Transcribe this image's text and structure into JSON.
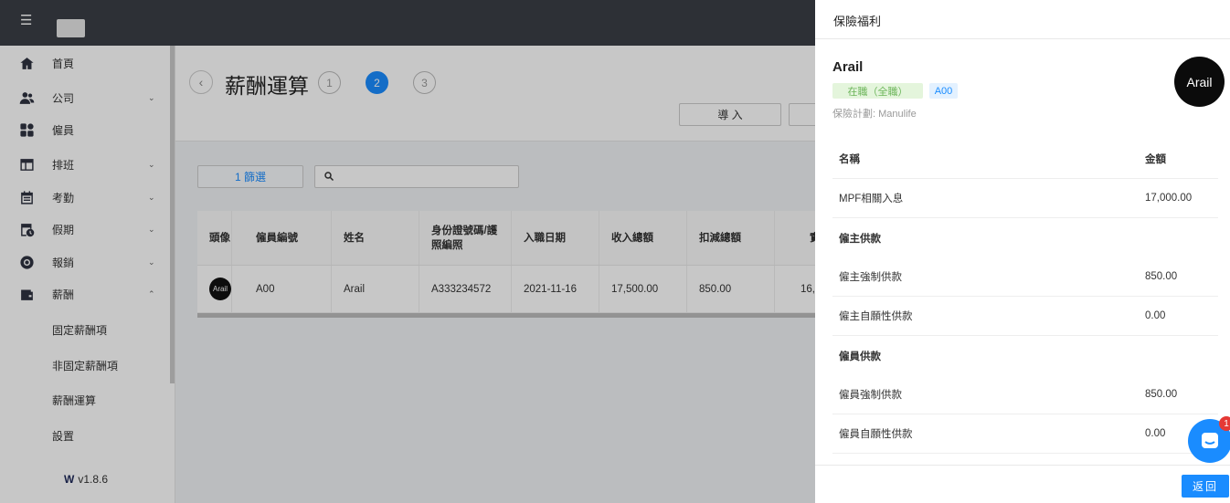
{
  "topbar": {
    "menu_icon": "list-icon",
    "logo": "app-logo"
  },
  "sidebar": {
    "items": [
      {
        "label": "首頁",
        "icon": "home-icon",
        "arrow": ""
      },
      {
        "label": "公司",
        "icon": "people-icon",
        "arrow": "⌄"
      },
      {
        "label": "僱員",
        "icon": "grid-icon",
        "arrow": ""
      },
      {
        "label": "排班",
        "icon": "calendar-grid-icon",
        "arrow": "⌄"
      },
      {
        "label": "考勤",
        "icon": "clipboard-icon",
        "arrow": "⌄"
      },
      {
        "label": "假期",
        "icon": "calendar-clock-icon",
        "arrow": "⌄"
      },
      {
        "label": "報銷",
        "icon": "coin-icon",
        "arrow": "⌄"
      },
      {
        "label": "薪酬",
        "icon": "wallet-icon",
        "arrow": "⌃"
      }
    ],
    "sub_items": [
      "固定薪酬項",
      "非固定薪酬項",
      "薪酬運算",
      "設置"
    ],
    "version": "v1.8.6"
  },
  "header": {
    "title": "薪酬運算",
    "steps": [
      "1",
      "2",
      "3"
    ],
    "active_step": "2",
    "import_label": "導 入"
  },
  "filter": {
    "label": "1  篩選",
    "search_placeholder": ""
  },
  "table": {
    "columns": [
      "頭像",
      "僱員編號",
      "姓名",
      "身份證號碼/護照編照",
      "入職日期",
      "收入總額",
      "扣減總額",
      "實"
    ],
    "rows": [
      {
        "avatar": "Arail",
        "id": "A00",
        "name": "Arail",
        "idno": "A333234572",
        "date": "2021-11-16",
        "income": "17,500.00",
        "deduct": "850.00",
        "net": "16,"
      }
    ]
  },
  "drawer": {
    "title": "保險福利",
    "name": "Arail",
    "status": "在職（全職）",
    "code": "A00",
    "plan": "保險計劃: Manulife",
    "avatar": "Arail",
    "headers": {
      "name": "名稱",
      "amount": "金額"
    },
    "rows": [
      {
        "name": "MPF相關入息",
        "amount": "17,000.00",
        "group": false
      },
      {
        "name": "僱主供款",
        "amount": "",
        "group": true
      },
      {
        "name": "僱主強制供款",
        "amount": "850.00",
        "group": false
      },
      {
        "name": "僱主自願性供款",
        "amount": "0.00",
        "group": false
      },
      {
        "name": "僱員供款",
        "amount": "",
        "group": true
      },
      {
        "name": "僱員強制供款",
        "amount": "850.00",
        "group": false
      },
      {
        "name": "僱員自願性供款",
        "amount": "0.00",
        "group": false
      }
    ],
    "return_label": "返回"
  },
  "chat": {
    "badge": "1"
  }
}
